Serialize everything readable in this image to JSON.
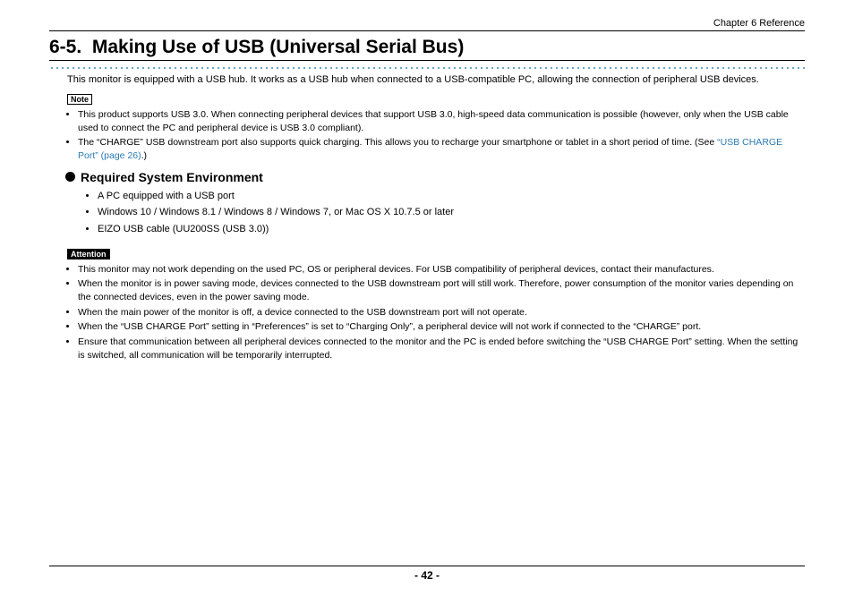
{
  "header": {
    "chapter": "Chapter 6   Reference"
  },
  "section": {
    "number": "6-5.",
    "title": "Making Use of USB (Universal Serial Bus)"
  },
  "intro": "This monitor is equipped with a USB hub. It works as a USB hub when connected to a USB-compatible PC, allowing the connection of peripheral USB devices.",
  "note": {
    "label": "Note",
    "items": [
      "This product supports USB 3.0. When connecting peripheral devices that support USB 3.0, high-speed data communication is possible (however, only when the USB cable used to connect the PC and peripheral device is USB 3.0 compliant).",
      "The “CHARGE” USB downstream port also supports quick charging. This allows you to recharge your smartphone or tablet in a short period of time. (See "
    ],
    "link_text": "“USB CHARGE Port” (page 26)",
    "link_suffix": ".)"
  },
  "subhead": "Required System Environment",
  "requirements": [
    "A PC equipped with a USB port",
    "Windows 10 / Windows 8.1 / Windows 8 / Windows 7, or Mac OS X 10.7.5 or later",
    "EIZO USB cable (UU200SS (USB 3.0))"
  ],
  "attention": {
    "label": "Attention",
    "items": [
      "This monitor may not work depending on the used PC, OS or peripheral devices. For USB compatibility of peripheral devices, contact their manufactures.",
      "When the monitor is in power saving mode, devices connected to the USB downstream port will still work. Therefore, power consumption of the monitor varies depending on the connected devices, even in the power saving mode.",
      "When the main power of the monitor is off, a device connected to the USB downstream port will not operate.",
      "When the “USB CHARGE Port” setting in “Preferences” is set to “Charging Only”, a peripheral device will not work if connected to the “CHARGE” port.",
      "Ensure that communication between all peripheral devices connected to the monitor and the PC is ended before switching the “USB CHARGE Port” setting. When the setting is switched, all communication will be temporarily interrupted."
    ]
  },
  "footer": {
    "page": "- 42 -"
  }
}
